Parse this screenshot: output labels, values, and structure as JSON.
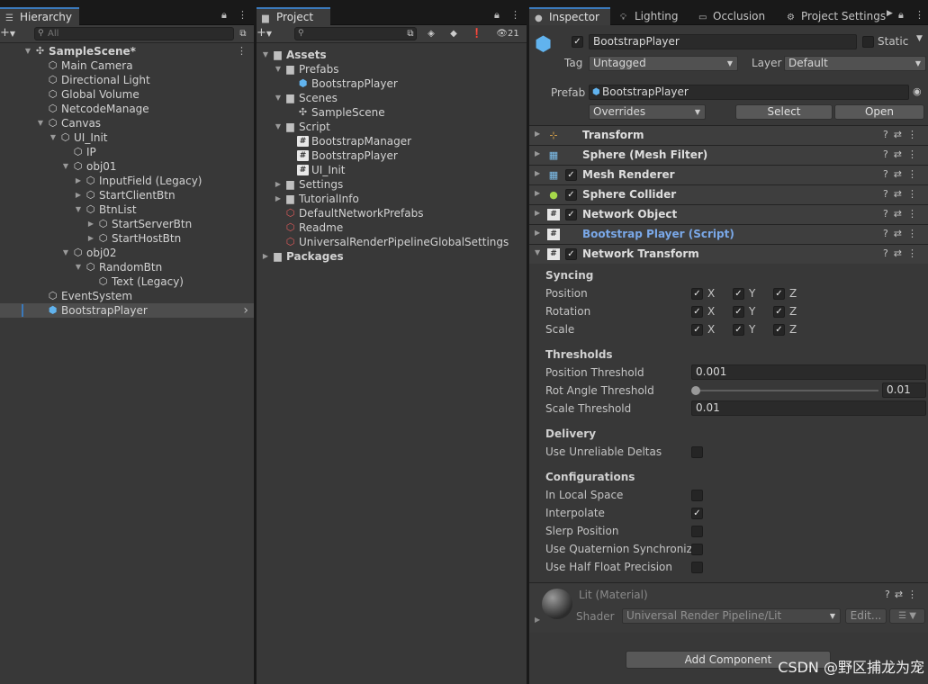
{
  "hierarchy": {
    "tab": "Hierarchy",
    "search_placeholder": "All",
    "rows": [
      {
        "label": "SampleScene*",
        "depth": 0,
        "arrow": "▼",
        "icon": "unity",
        "bold": true
      },
      {
        "label": "Main Camera",
        "depth": 1,
        "arrow": "",
        "icon": "cube"
      },
      {
        "label": "Directional Light",
        "depth": 1,
        "arrow": "",
        "icon": "cube"
      },
      {
        "label": "Global Volume",
        "depth": 1,
        "arrow": "",
        "icon": "cube"
      },
      {
        "label": "NetcodeManage",
        "depth": 1,
        "arrow": "",
        "icon": "cube"
      },
      {
        "label": "Canvas",
        "depth": 1,
        "arrow": "▼",
        "icon": "cube"
      },
      {
        "label": "UI_Init",
        "depth": 2,
        "arrow": "▼",
        "icon": "cube"
      },
      {
        "label": "IP",
        "depth": 3,
        "arrow": "",
        "icon": "cube"
      },
      {
        "label": "obj01",
        "depth": 3,
        "arrow": "▼",
        "icon": "cube"
      },
      {
        "label": "InputField (Legacy)",
        "depth": 4,
        "arrow": "▶",
        "icon": "cube"
      },
      {
        "label": "StartClientBtn",
        "depth": 4,
        "arrow": "▶",
        "icon": "cube"
      },
      {
        "label": "BtnList",
        "depth": 4,
        "arrow": "▼",
        "icon": "cube"
      },
      {
        "label": "StartServerBtn",
        "depth": 5,
        "arrow": "▶",
        "icon": "cube"
      },
      {
        "label": "StartHostBtn",
        "depth": 5,
        "arrow": "▶",
        "icon": "cube"
      },
      {
        "label": "obj02",
        "depth": 3,
        "arrow": "▼",
        "icon": "cube"
      },
      {
        "label": "RandomBtn",
        "depth": 4,
        "arrow": "▼",
        "icon": "cube"
      },
      {
        "label": "Text (Legacy)",
        "depth": 5,
        "arrow": "",
        "icon": "cube"
      },
      {
        "label": "EventSystem",
        "depth": 1,
        "arrow": "",
        "icon": "cube"
      },
      {
        "label": "BootstrapPlayer",
        "depth": 1,
        "arrow": "",
        "icon": "blue",
        "selected": true
      }
    ]
  },
  "project": {
    "tab": "Project",
    "hidden_count": "21",
    "rows": [
      {
        "label": "Assets",
        "depth": 0,
        "arrow": "▼",
        "icon": "folder",
        "bold": true
      },
      {
        "label": "Prefabs",
        "depth": 1,
        "arrow": "▼",
        "icon": "folder"
      },
      {
        "label": "BootstrapPlayer",
        "depth": 2,
        "arrow": "",
        "icon": "blue"
      },
      {
        "label": "Scenes",
        "depth": 1,
        "arrow": "▼",
        "icon": "folder"
      },
      {
        "label": "SampleScene",
        "depth": 2,
        "arrow": "",
        "icon": "unity"
      },
      {
        "label": "Script",
        "depth": 1,
        "arrow": "▼",
        "icon": "folder"
      },
      {
        "label": "BootstrapManager",
        "depth": 2,
        "arrow": "",
        "icon": "script"
      },
      {
        "label": "BootstrapPlayer",
        "depth": 2,
        "arrow": "",
        "icon": "script"
      },
      {
        "label": "UI_Init",
        "depth": 2,
        "arrow": "",
        "icon": "script"
      },
      {
        "label": "Settings",
        "depth": 1,
        "arrow": "▶",
        "icon": "folder"
      },
      {
        "label": "TutorialInfo",
        "depth": 1,
        "arrow": "▶",
        "icon": "folder"
      },
      {
        "label": "DefaultNetworkPrefabs",
        "depth": 1,
        "arrow": "",
        "icon": "asset"
      },
      {
        "label": "Readme",
        "depth": 1,
        "arrow": "",
        "icon": "asset"
      },
      {
        "label": "UniversalRenderPipelineGlobalSettings",
        "depth": 1,
        "arrow": "",
        "icon": "asset"
      },
      {
        "label": "Packages",
        "depth": 0,
        "arrow": "▶",
        "icon": "folder",
        "bold": true
      }
    ]
  },
  "inspector": {
    "tabs": {
      "inspector": "Inspector",
      "lighting": "Lighting",
      "occlusion": "Occlusion",
      "project_settings": "Project Settings"
    },
    "object_name": "BootstrapPlayer",
    "static_label": "Static",
    "tag_label": "Tag",
    "tag_value": "Untagged",
    "layer_label": "Layer",
    "layer_value": "Default",
    "prefab_label": "Prefab",
    "prefab_value": "BootstrapPlayer",
    "overrides": "Overrides",
    "select": "Select",
    "open": "Open",
    "components": [
      {
        "name": "Transform",
        "icon": "transform-icon",
        "checkbox": false,
        "arrow": "▶"
      },
      {
        "name": "Sphere (Mesh Filter)",
        "icon": "mesh-filter-icon",
        "checkbox": false,
        "arrow": "▶"
      },
      {
        "name": "Mesh Renderer",
        "icon": "mesh-renderer-icon",
        "checkbox": true,
        "arrow": "▶"
      },
      {
        "name": "Sphere Collider",
        "icon": "sphere-collider-icon",
        "checkbox": true,
        "arrow": "▶"
      },
      {
        "name": "Network Object",
        "icon": "script-icon",
        "checkbox": true,
        "arrow": "▶"
      },
      {
        "name": "Bootstrap Player (Script)",
        "icon": "script-icon",
        "checkbox": false,
        "arrow": "▶",
        "script": true
      },
      {
        "name": "Network Transform",
        "icon": "script-icon",
        "checkbox": true,
        "arrow": "▼"
      }
    ],
    "syncing": {
      "title": "Syncing",
      "rows": [
        {
          "label": "Position",
          "x": true,
          "y": true,
          "z": true
        },
        {
          "label": "Rotation",
          "x": true,
          "y": true,
          "z": true
        },
        {
          "label": "Scale",
          "x": true,
          "y": true,
          "z": true
        }
      ],
      "axis_x": "X",
      "axis_y": "Y",
      "axis_z": "Z"
    },
    "thresholds": {
      "title": "Thresholds",
      "position_label": "Position Threshold",
      "position_value": "0.001",
      "rot_label": "Rot Angle Threshold",
      "rot_value": "0.01",
      "rot_slider_fraction": 0.0,
      "scale_label": "Scale Threshold",
      "scale_value": "0.01"
    },
    "delivery": {
      "title": "Delivery",
      "rows": [
        {
          "label": "Use Unreliable Deltas",
          "checked": false
        }
      ]
    },
    "configurations": {
      "title": "Configurations",
      "rows": [
        {
          "label": "In Local Space",
          "checked": false
        },
        {
          "label": "Interpolate",
          "checked": true
        },
        {
          "label": "Slerp Position",
          "checked": false
        },
        {
          "label": "Use Quaternion Synchroniza",
          "checked": false
        },
        {
          "label": "Use Half Float Precision",
          "checked": false
        }
      ]
    },
    "material": {
      "name": "Lit (Material)",
      "shader_label": "Shader",
      "shader_value": "Universal Render Pipeline/Lit",
      "edit": "Edit..."
    },
    "add_component": "Add Component"
  },
  "watermark": "CSDN @野区捕龙为宠",
  "colors": {
    "accent": "#3a79bb",
    "script_name": "#7aa8e8",
    "selection": "#4d4d4d"
  }
}
